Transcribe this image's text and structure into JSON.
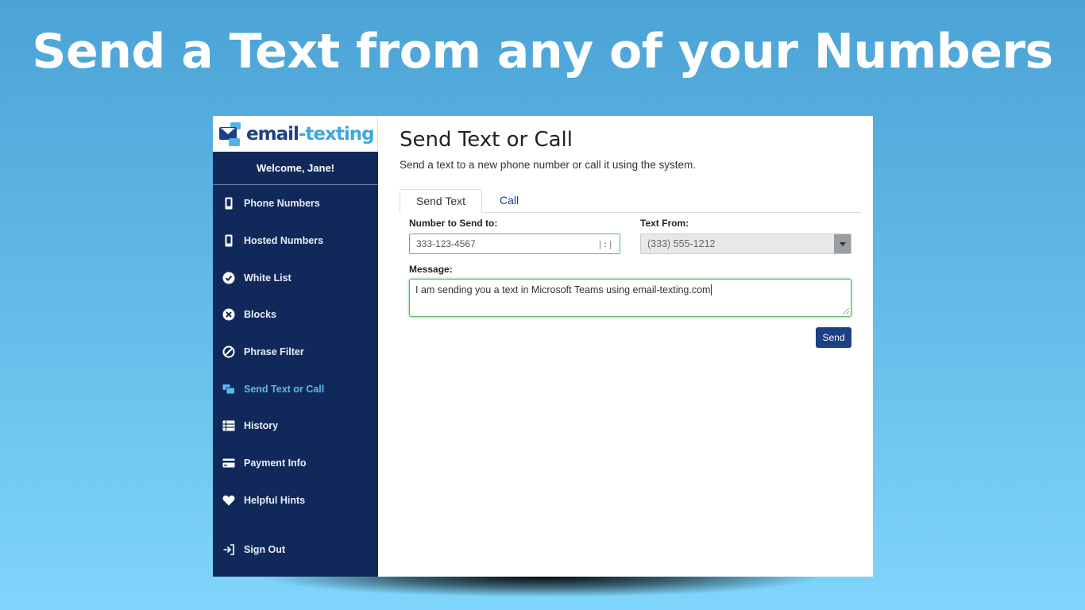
{
  "headline": "Send a Text from any of your Numbers",
  "logo": {
    "text_main": "email",
    "text_accent": "-texting"
  },
  "sidebar": {
    "welcome": "Welcome, Jane!",
    "items": [
      {
        "label": "Phone Numbers",
        "icon": "phone-icon"
      },
      {
        "label": "Hosted Numbers",
        "icon": "phone-icon"
      },
      {
        "label": "White List",
        "icon": "check-circle-icon"
      },
      {
        "label": "Blocks",
        "icon": "x-circle-icon"
      },
      {
        "label": "Phrase Filter",
        "icon": "ban-icon"
      },
      {
        "label": "Send Text or Call",
        "icon": "chat-bubbles-icon",
        "active": true
      },
      {
        "label": "History",
        "icon": "list-icon"
      },
      {
        "label": "Payment Info",
        "icon": "credit-card-icon"
      },
      {
        "label": "Helpful Hints",
        "icon": "heart-icon"
      }
    ],
    "signout": {
      "label": "Sign Out",
      "icon": "sign-out-icon"
    }
  },
  "main": {
    "title": "Send Text or Call",
    "subtitle": "Send a text to a new phone number or call it using the system.",
    "tabs": [
      {
        "label": "Send Text",
        "active": true
      },
      {
        "label": "Call",
        "active": false
      }
    ],
    "form": {
      "number_label": "Number to Send to:",
      "number_value": "333-123-4567",
      "from_label": "Text From:",
      "from_value": "(333) 555-1212",
      "message_label": "Message:",
      "message_value": "I am sending you a text in Microsoft Teams using email-texting.com",
      "send_label": "Send"
    }
  },
  "colors": {
    "sidebar_bg": "#11295a",
    "brand_blue": "#1d3f86",
    "accent_blue": "#5cb7ee",
    "focus_green": "#5db66a"
  }
}
